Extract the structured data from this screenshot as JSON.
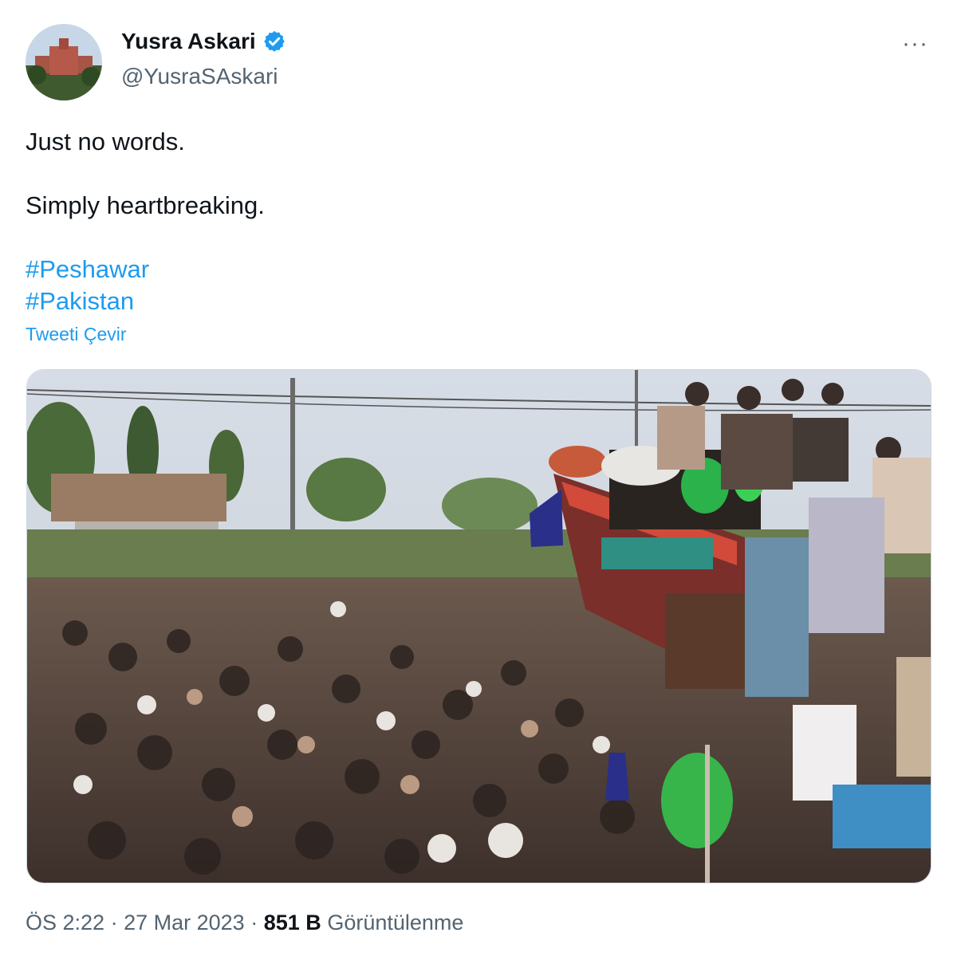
{
  "author": {
    "display_name": "Yusra Askari",
    "handle": "@YusraSAskari",
    "verified": true,
    "accent_color": "#1d9bf0"
  },
  "menu": {
    "more_label": "···"
  },
  "tweet": {
    "lines": [
      "Just no words.",
      "",
      "Simply heartbreaking.",
      ""
    ],
    "hashtags": [
      "#Peshawar",
      "#Pakistan"
    ],
    "translate_label": "Tweeti Çevir"
  },
  "media": {
    "type": "video"
  },
  "meta": {
    "time": "ÖS 2:22",
    "separator": "·",
    "date": "27 Mar 2023",
    "views_count": "851 B",
    "views_label": "Görüntülenme"
  }
}
